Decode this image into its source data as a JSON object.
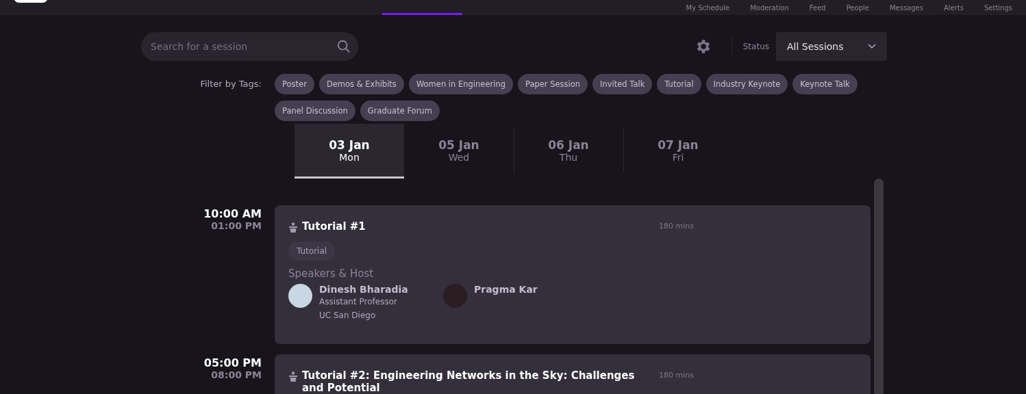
{
  "nav": {
    "items": [
      {
        "label": "My Schedule",
        "selected": false
      },
      {
        "label": "Moderation",
        "selected": false
      },
      {
        "label": "Feed",
        "selected": false
      },
      {
        "label": "People",
        "selected": false
      },
      {
        "label": "Messages",
        "selected": false
      },
      {
        "label": "Alerts",
        "selected": false
      },
      {
        "label": "Settings",
        "selected": false
      }
    ]
  },
  "search": {
    "placeholder": "Search for a session"
  },
  "status": {
    "label": "Status",
    "value": "All Sessions"
  },
  "tags": {
    "label": "Filter by Tags:",
    "items": [
      {
        "label": "Poster"
      },
      {
        "label": "Demos & Exhibits"
      },
      {
        "label": "Women in Engineering"
      },
      {
        "label": "Paper Session"
      },
      {
        "label": "Invited Talk"
      },
      {
        "label": "Tutorial"
      },
      {
        "label": "Industry Keynote"
      },
      {
        "label": "Keynote Talk"
      },
      {
        "label": "Panel Discussion"
      },
      {
        "label": "Graduate Forum"
      }
    ]
  },
  "days": [
    {
      "date": "03 Jan",
      "weekday": "Mon",
      "selected": true
    },
    {
      "date": "05 Jan",
      "weekday": "Wed",
      "selected": false
    },
    {
      "date": "06 Jan",
      "weekday": "Thu",
      "selected": false
    },
    {
      "date": "07 Jan",
      "weekday": "Fri",
      "selected": false
    }
  ],
  "sessions": [
    {
      "start": "10:00 AM",
      "end": "01:00 PM",
      "title": "Tutorial #1",
      "duration": "180 mins",
      "tag": "Tutorial",
      "speakers_label": "Speakers & Host",
      "speakers": [
        {
          "name": "Dinesh Bharadia",
          "role": "Assistant Professor",
          "org": "UC San Diego"
        },
        {
          "name": "Pragma Kar"
        }
      ]
    },
    {
      "start": "05:00 PM",
      "end": "08:00 PM",
      "title": "Tutorial #2: Engineering Networks in the Sky: Challenges and Potential",
      "duration": "180 mins"
    }
  ]
}
